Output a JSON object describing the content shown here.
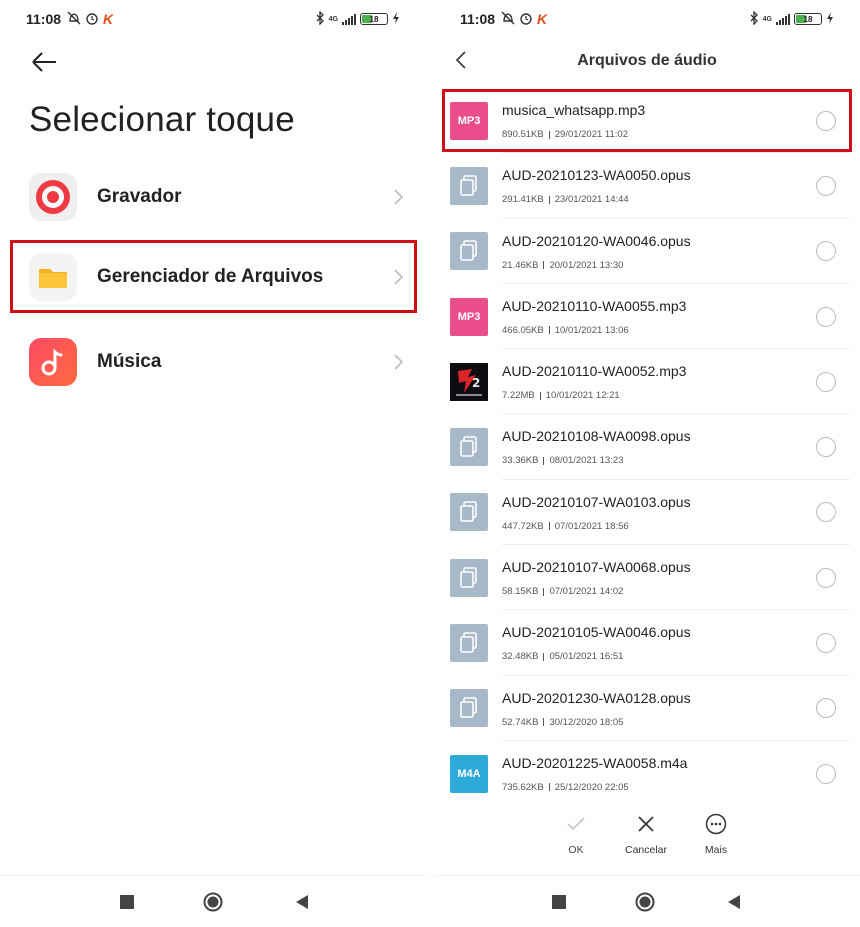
{
  "status_bar": {
    "time": "11:08",
    "network": "4G",
    "battery": "18"
  },
  "left_screen": {
    "title": "Selecionar toque",
    "items": [
      {
        "label": "Gravador",
        "icon": "recorder-icon"
      },
      {
        "label": "Gerenciador de Arquivos",
        "icon": "folder-icon"
      },
      {
        "label": "Música",
        "icon": "music-note-icon"
      }
    ]
  },
  "right_screen": {
    "title": "Arquivos de áudio",
    "files": [
      {
        "name": "musica_whatsapp.mp3",
        "size": "890.51KB",
        "date": "29/01/2021 11:02",
        "type": "MP3"
      },
      {
        "name": "AUD-20210123-WA0050.opus",
        "size": "291.41KB",
        "date": "23/01/2021 14:44",
        "type": "doc"
      },
      {
        "name": "AUD-20210120-WA0046.opus",
        "size": "21.46KB",
        "date": "20/01/2021 13:30",
        "type": "doc"
      },
      {
        "name": "AUD-20210110-WA0055.mp3",
        "size": "466.05KB",
        "date": "10/01/2021 13:06",
        "type": "MP3"
      },
      {
        "name": "AUD-20210110-WA0052.mp3",
        "size": "7.22MB",
        "date": "10/01/2021 12:21",
        "type": "img"
      },
      {
        "name": "AUD-20210108-WA0098.opus",
        "size": "33.36KB",
        "date": "08/01/2021 13:23",
        "type": "doc"
      },
      {
        "name": "AUD-20210107-WA0103.opus",
        "size": "447.72KB",
        "date": "07/01/2021 18:56",
        "type": "doc"
      },
      {
        "name": "AUD-20210107-WA0068.opus",
        "size": "58.15KB",
        "date": "07/01/2021 14:02",
        "type": "doc"
      },
      {
        "name": "AUD-20210105-WA0046.opus",
        "size": "32.48KB",
        "date": "05/01/2021 16:51",
        "type": "doc"
      },
      {
        "name": "AUD-20201230-WA0128.opus",
        "size": "52.74KB",
        "date": "30/12/2020 18:05",
        "type": "doc"
      },
      {
        "name": "AUD-20201225-WA0058.m4a",
        "size": "735.62KB",
        "date": "25/12/2020 22:05",
        "type": "M4A"
      }
    ],
    "actions": {
      "ok": "OK",
      "cancel": "Cancelar",
      "more": "Mais"
    }
  },
  "colors": {
    "highlight": "#d01018",
    "mp3": "#e94e8a",
    "m4a": "#2eaad9",
    "doc": "#a7b8c8"
  }
}
